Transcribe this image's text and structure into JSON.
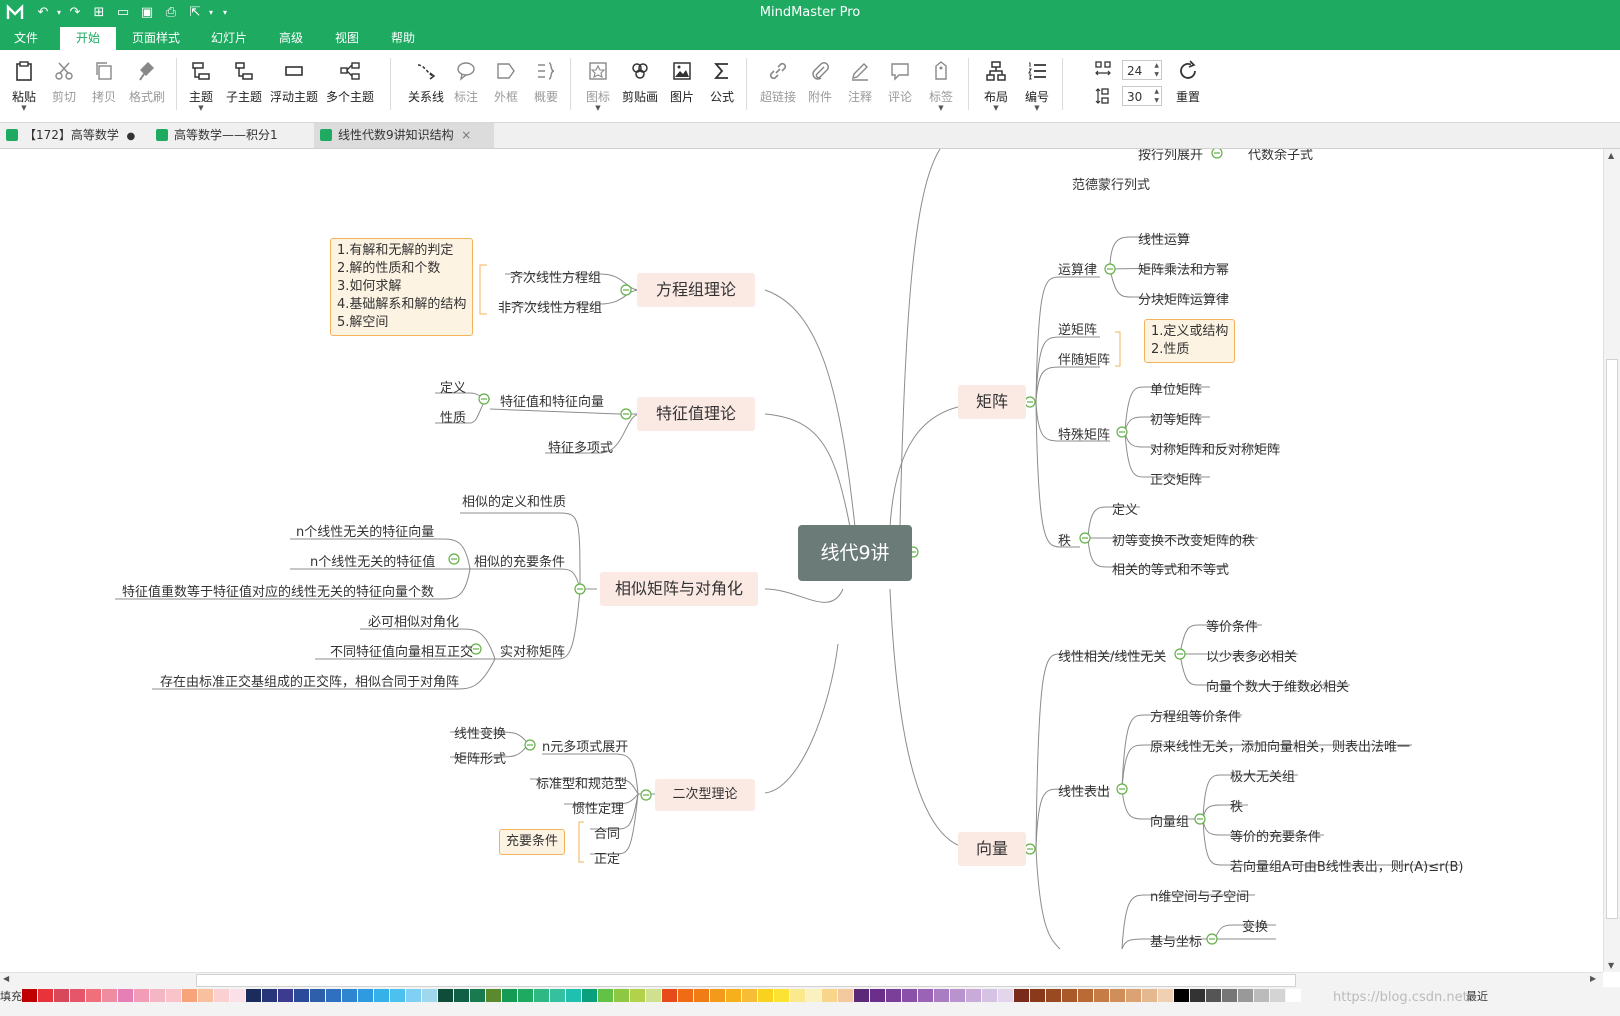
{
  "app": {
    "title": "MindMaster Pro"
  },
  "menu": {
    "tabs": [
      "文件",
      "开始",
      "页面样式",
      "幻灯片",
      "高级",
      "视图",
      "帮助"
    ],
    "active": "开始"
  },
  "ribbon": {
    "paste": "粘贴",
    "cut": "剪切",
    "copy": "拷贝",
    "format_brush": "格式刷",
    "topic": "主题",
    "subtopic": "子主题",
    "floating_topic": "浮动主题",
    "multi_topic": "多个主题",
    "relationship": "关系线",
    "callout": "标注",
    "boundary": "外框",
    "summary": "概要",
    "icon": "图标",
    "clipart": "剪贴画",
    "image": "图片",
    "formula": "公式",
    "hyperlink": "超链接",
    "attachment": "附件",
    "note": "注释",
    "comment": "评论",
    "tag": "标签",
    "layout": "布局",
    "numbering": "编号",
    "spacing_h": "24",
    "spacing_v": "30",
    "reset": "重置"
  },
  "doc_tabs": [
    {
      "label": "【172】高等数学",
      "modified": "●"
    },
    {
      "label": "高等数学——积分1"
    },
    {
      "label": "线性代数9讲知识结构",
      "close": "×"
    }
  ],
  "mindmap": {
    "center": "线代9讲",
    "left": {
      "fangcheng": {
        "title": "方程组理论",
        "children": [
          "齐次线性方程组",
          "非齐次线性方程组"
        ],
        "note": [
          "1.有解和无解的判定",
          "2.解的性质和个数",
          "3.如何求解",
          "4.基础解系和解的结构",
          "5.解空间"
        ]
      },
      "tezheng": {
        "title": "特征值理论",
        "c1": "特征值和特征向量",
        "c1_children": [
          "定义",
          "性质"
        ],
        "c2": "特征多项式"
      },
      "xiangsi": {
        "title": "相似矩阵与对角化",
        "c1": "相似的定义和性质",
        "c2": "相似的充要条件",
        "c2_children": [
          "n个线性无关的特征向量",
          "n个线性无关的特征值",
          "特征值重数等于特征值对应的线性无关的特征向量个数"
        ],
        "c3": "实对称矩阵",
        "c3_children": [
          "必可相似对角化",
          "不同特征值向量相互正交",
          "存在由标准正交基组成的正交阵，相似合同于对角阵"
        ]
      },
      "erci": {
        "title": "二次型理论",
        "c1": "n元多项式展开",
        "c1_children": [
          "线性变换",
          "矩阵形式"
        ],
        "c2": "标准型和规范型",
        "c3": "惯性定理",
        "c4": "合同",
        "c5": "正定",
        "note": "充要条件"
      }
    },
    "right": {
      "top": {
        "expand": "按行列展开",
        "cofactor": "代数余子式",
        "vandermonde": "范德蒙行列式"
      },
      "juzhen": {
        "title": "矩阵",
        "yunsuan": "运算律",
        "yunsuan_children": [
          "线性运算",
          "矩阵乘法和方幂",
          "分块矩阵运算律"
        ],
        "ni": "逆矩阵",
        "banshui": "伴随矩阵",
        "note": [
          "1.定义或结构",
          "2.性质"
        ],
        "teshu": "特殊矩阵",
        "teshu_children": [
          "单位矩阵",
          "初等矩阵",
          "对称矩阵和反对称矩阵",
          "正交矩阵"
        ],
        "zhi": "秩",
        "zhi_children": [
          "定义",
          "初等变换不改变矩阵的秩",
          "相关的等式和不等式"
        ]
      },
      "xiangliang": {
        "title": "向量",
        "xg": "线性相关/线性无关",
        "xg_children": [
          "等价条件",
          "以少表多必相关",
          "向量个数大于维数必相关"
        ],
        "bc": "线性表出",
        "bc_children": [
          "方程组等价条件",
          "原来线性无关，添加向量相关，则表出法唯一"
        ],
        "xlz": "向量组",
        "xlz_children": [
          "极大无关组",
          "秩",
          "等价的充要条件",
          "若向量组A可由B线性表出，则r(A)≤r(B)"
        ],
        "nwei": "n维空间与子空间",
        "jizuobiao": "基与坐标",
        "bianhuan": "变换"
      }
    }
  },
  "palette": {
    "fill_label": "填充",
    "recent_label": "最近",
    "colors": [
      "#c00000",
      "#e8333a",
      "#d9475a",
      "#e6566b",
      "#ef6f7b",
      "#f08ca2",
      "#e67fb5",
      "#f29cb8",
      "#f4b6c5",
      "#f9c3c9",
      "#f7a47a",
      "#f9c0a0",
      "#fad1d0",
      "#fbe0e8",
      "#1b2c5c",
      "#27367a",
      "#3b3b8f",
      "#2a4a9a",
      "#2d5fab",
      "#3070c0",
      "#2e86d0",
      "#2e9be0",
      "#36b0e8",
      "#4cc0ef",
      "#7fd0f2",
      "#9fd8ec",
      "#0f4d3a",
      "#0f6046",
      "#1a7a4f",
      "#5b8a2e",
      "#169b55",
      "#1faa62",
      "#2eb883",
      "#35c0a0",
      "#20c0b0",
      "#0aa07c",
      "#62c246",
      "#8ec742",
      "#b1d24a",
      "#cfe08f",
      "#e84b1a",
      "#ef6b14",
      "#f07c15",
      "#f39a1a",
      "#f5b01c",
      "#f7bd35",
      "#f8d21e",
      "#fbe233",
      "#fbe98e",
      "#fbf0c0",
      "#f7d58a",
      "#f3c9a0",
      "#5a2a78",
      "#6a2f8a",
      "#7b3f9a",
      "#8a50aa",
      "#9b63b5",
      "#aa7cc2",
      "#b993cd",
      "#c8abd8",
      "#d6c2e2",
      "#e3d6ec",
      "#7a2a1a",
      "#8a3a1a",
      "#9a4a22",
      "#aa5a2a",
      "#b96a35",
      "#c57d45",
      "#d08f5a",
      "#dba373",
      "#e5b990",
      "#efd0b2",
      "#000000",
      "#333333",
      "#555555",
      "#777777",
      "#999999",
      "#bbbbbb",
      "#d4d4d4",
      "#ffffff"
    ]
  },
  "watermark": "https://blog.csdn.net/..."
}
